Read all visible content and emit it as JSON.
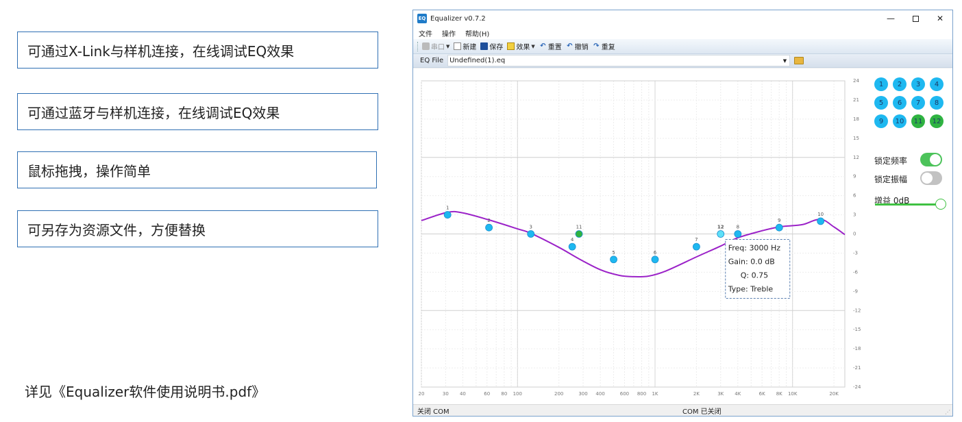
{
  "features": [
    "可通过X-Link与样机连接，在线调试EQ效果",
    "可通过蓝牙与样机连接，在线调试EQ效果",
    "鼠标拖拽，操作简单",
    "可另存为资源文件，方便替换"
  ],
  "footnote": "详见《Equalizer软件使用说明书.pdf》",
  "window": {
    "icon_text": "EQ",
    "title": "Equalizer v0.7.2",
    "controls": {
      "minimize": "—",
      "close": "✕"
    }
  },
  "menu": [
    "文件",
    "操作",
    "帮助(H)"
  ],
  "toolbar": {
    "port": "串口",
    "new": "新建",
    "save": "保存",
    "effect": "效果",
    "reset": "重置",
    "undo": "撤销",
    "redo": "重复",
    "icons": {
      "reset": "↶",
      "undo": "↶",
      "redo": "↷"
    }
  },
  "eq_file": {
    "label": "EQ File",
    "value": "Undefined(1).eq"
  },
  "chart_data": {
    "type": "line",
    "xscale": "log",
    "x_ticks": [
      20,
      30,
      40,
      60,
      80,
      100,
      200,
      300,
      400,
      600,
      800,
      1000,
      2000,
      3000,
      4000,
      6000,
      8000,
      10000,
      20000
    ],
    "x_tick_labels": [
      "20",
      "30",
      "40",
      "60",
      "80",
      "100",
      "200",
      "300",
      "400",
      "600",
      "800",
      "1K",
      "2K",
      "3K",
      "4K",
      "6K",
      "8K",
      "10K",
      "20K"
    ],
    "xlim": [
      20,
      24000
    ],
    "ylim": [
      -24,
      24
    ],
    "y_ticks": [
      24,
      21,
      18,
      15,
      12,
      9,
      6,
      3,
      0,
      -3,
      -6,
      -9,
      -12,
      -15,
      -18,
      -21,
      -24
    ],
    "points": [
      {
        "label": "1",
        "freq": 31,
        "gain": 3.0,
        "color": "#1eb8f0"
      },
      {
        "label": "2",
        "freq": 62,
        "gain": 1.0,
        "color": "#1eb8f0"
      },
      {
        "label": "3",
        "freq": 125,
        "gain": 0.0,
        "color": "#1eb8f0"
      },
      {
        "label": "4",
        "freq": 250,
        "gain": -2.0,
        "color": "#1eb8f0"
      },
      {
        "label": "11",
        "freq": 280,
        "gain": 0.0,
        "color": "#2fb341"
      },
      {
        "label": "5",
        "freq": 500,
        "gain": -4.0,
        "color": "#1eb8f0"
      },
      {
        "label": "6",
        "freq": 1000,
        "gain": -4.0,
        "color": "#1eb8f0"
      },
      {
        "label": "7",
        "freq": 2000,
        "gain": -2.0,
        "color": "#1eb8f0"
      },
      {
        "label": "12",
        "freq": 3000,
        "gain": 0.0,
        "color": "#5ee0f8",
        "selected": true
      },
      {
        "label": "8",
        "freq": 4000,
        "gain": 0.0,
        "color": "#1eb8f0"
      },
      {
        "label": "9",
        "freq": 8000,
        "gain": 1.0,
        "color": "#1eb8f0"
      },
      {
        "label": "10",
        "freq": 16000,
        "gain": 2.0,
        "color": "#1eb8f0"
      }
    ],
    "curve": {
      "name": "response",
      "color": "#9b22c8",
      "x": [
        20,
        31,
        40,
        62,
        100,
        125,
        200,
        280,
        400,
        550,
        700,
        900,
        1200,
        2000,
        3000,
        4000,
        6000,
        8000,
        10000,
        12000,
        16000,
        20000,
        24000
      ],
      "y": [
        2.1,
        3.4,
        3.3,
        2.2,
        0.8,
        0.1,
        -2.1,
        -3.9,
        -5.6,
        -6.5,
        -6.7,
        -6.6,
        -5.8,
        -3.6,
        -1.9,
        -0.6,
        0.5,
        1.1,
        1.3,
        1.5,
        2.3,
        1.1,
        -0.1
      ]
    },
    "tooltip": [
      "Freq: 3000 Hz",
      "Gain: 0.0 dB",
      "Q: 0.75",
      "Type: Treble"
    ]
  },
  "bands": [
    {
      "label": "1",
      "color": "#1eb8f0"
    },
    {
      "label": "2",
      "color": "#1eb8f0"
    },
    {
      "label": "3",
      "color": "#1eb8f0"
    },
    {
      "label": "4",
      "color": "#1eb8f0"
    },
    {
      "label": "5",
      "color": "#1eb8f0"
    },
    {
      "label": "6",
      "color": "#1eb8f0"
    },
    {
      "label": "7",
      "color": "#1eb8f0"
    },
    {
      "label": "8",
      "color": "#1eb8f0"
    },
    {
      "label": "9",
      "color": "#1eb8f0"
    },
    {
      "label": "10",
      "color": "#1eb8f0"
    },
    {
      "label": "11",
      "color": "#2fb341"
    },
    {
      "label": "12",
      "color": "#2fb341"
    }
  ],
  "controls": {
    "lock_freq": {
      "label": "锁定频率",
      "on": true
    },
    "lock_amp": {
      "label": "锁定振幅",
      "on": false
    },
    "gain": {
      "label": "增益 0dB",
      "level": 1.0
    }
  },
  "status": {
    "left": "关闭 COM",
    "middle": "COM 已关闭"
  }
}
